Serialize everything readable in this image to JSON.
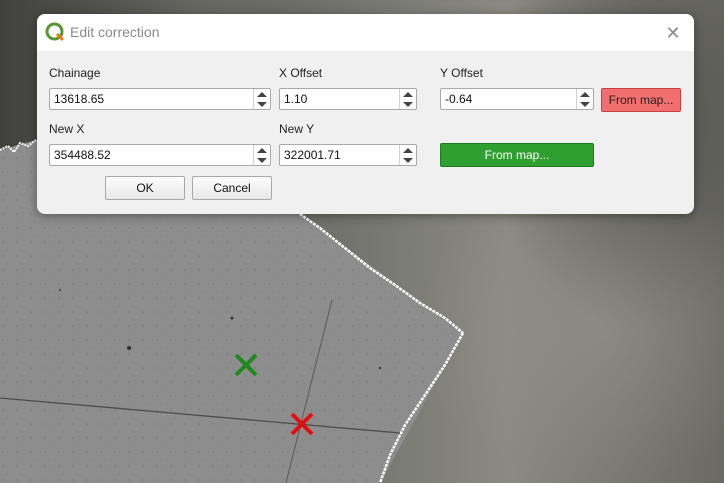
{
  "dialog": {
    "title": "Edit correction",
    "close_glyph": "✕"
  },
  "fields": {
    "chainage": {
      "label": "Chainage",
      "value": "13618.65"
    },
    "x_offset": {
      "label": "X Offset",
      "value": "1.10"
    },
    "y_offset": {
      "label": "Y Offset",
      "value": "-0.64"
    },
    "new_x": {
      "label": "New X",
      "value": "354488.52"
    },
    "new_y": {
      "label": "New Y",
      "value": "322001.71"
    }
  },
  "buttons": {
    "from_map_offset": "From map...",
    "from_map_new": "From map...",
    "ok": "OK",
    "cancel": "Cancel"
  },
  "colors": {
    "from_map_red": "#f26f6f",
    "from_map_green": "#2f9f2f",
    "marker_green": "#1e8a1e",
    "marker_red": "#e01010"
  },
  "icons": {
    "app": "qgis-logo-icon",
    "close": "close-icon",
    "markers": [
      "green-x-marker-icon",
      "red-x-marker-icon"
    ]
  }
}
